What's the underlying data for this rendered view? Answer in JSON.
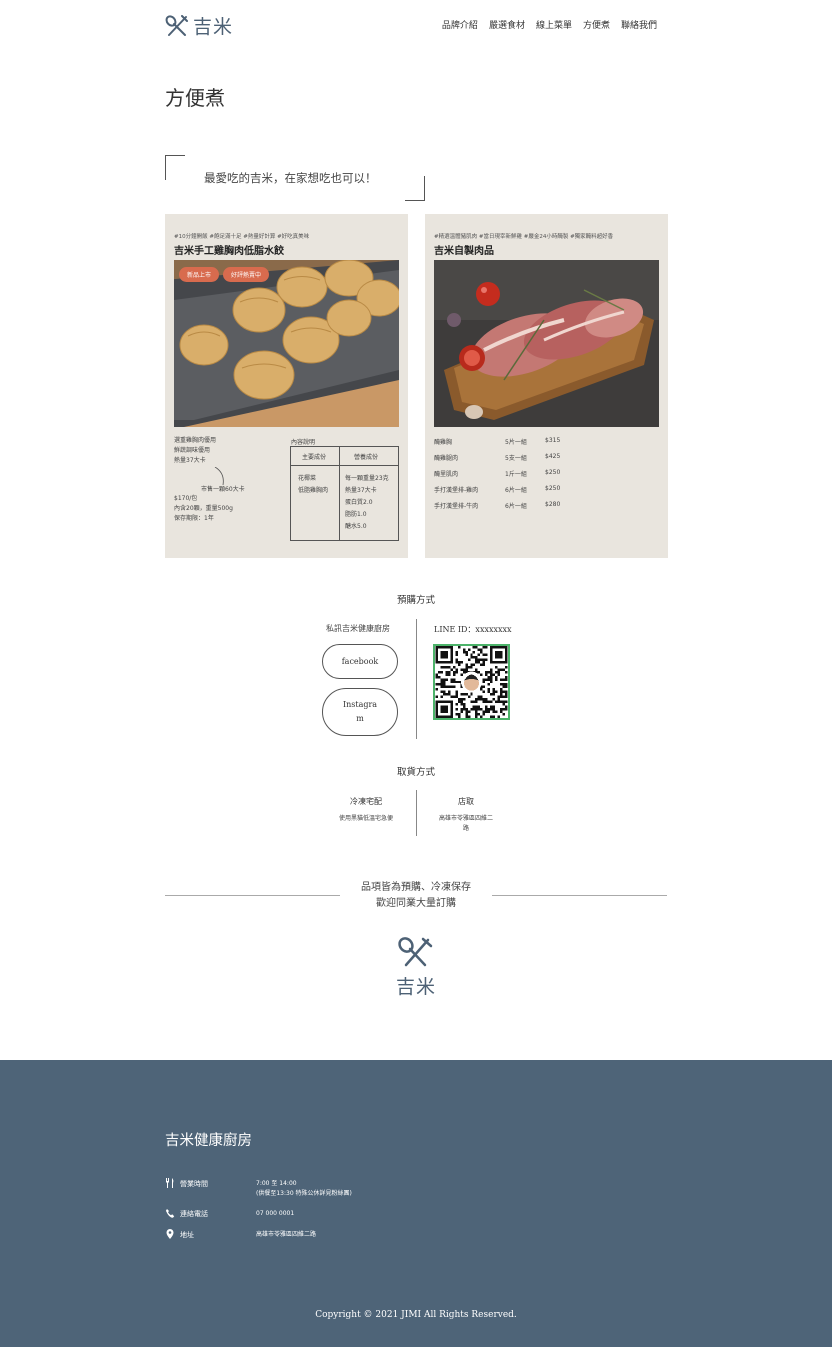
{
  "header": {
    "logo_text": "吉米",
    "nav": [
      "品牌介紹",
      "嚴選食材",
      "線上菜單",
      "方便煮",
      "聯絡我們"
    ]
  },
  "page_title": "方便煮",
  "quote": "最愛吃的吉米，在家想吃也可以！",
  "products": {
    "dumpling": {
      "tags": "#10分鐘開飯 #飽足滿十足 #熱量好計算 #好吃真美味",
      "title": "吉米手工雞胸肉低脂水餃",
      "badges": [
        "新品上市",
        "好評熱賣中"
      ],
      "spec_lines": [
        "選重雞胸肉優用",
        "鮮蔬調味優用",
        "熱量37大卡"
      ],
      "spec_note": "市售一顆60大卡",
      "spec_extra": [
        "$170/包",
        "內含20顆，重量500g",
        "保存期限：1年"
      ],
      "nutrition_label": "內容說明",
      "nutrition_headers": [
        "主要成份",
        "營養成份"
      ],
      "nutrition_main": [
        "花椰菜",
        "低脂雞胸肉"
      ],
      "nutrition_values": [
        "每一顆重量23克",
        "熱量37大卡",
        "蛋白質2.0",
        "脂肪1.0",
        "醣水5.0"
      ]
    },
    "meat": {
      "tags": "#精選溫體豬肌肉 #當日現宰新鮮雞 #嚴金24小時醃製 #獨家醃料超好香",
      "title": "吉米自製肉品",
      "prices": [
        {
          "name": "醃雞胸",
          "qty": "5片一組",
          "price": "$315"
        },
        {
          "name": "醃雞腿肉",
          "qty": "5支一組",
          "price": "$425"
        },
        {
          "name": "醃里肌肉",
          "qty": "1斤一組",
          "price": "$250"
        },
        {
          "name": "手打漢堡排-雞肉",
          "qty": "6片一組",
          "price": "$250"
        },
        {
          "name": "手打漢堡排-牛肉",
          "qty": "6片一組",
          "price": "$280"
        }
      ]
    }
  },
  "order": {
    "title": "預購方式",
    "left_label": "私訊吉米健康廚房",
    "facebook": "facebook",
    "instagram_1": "Instagra",
    "instagram_2": "m",
    "line_id": "LINE ID：xxxxxxxx"
  },
  "pickup": {
    "title": "取貨方式",
    "delivery_title": "冷凍宅配",
    "delivery_desc": "使用黑貓低溫宅急便",
    "store_title": "店取",
    "store_desc_1": "高雄市苓雅區四維二",
    "store_desc_2": "路"
  },
  "notice": [
    "品項皆為預購、冷凍保存",
    "歡迎同業大量訂購"
  ],
  "big_logo_text": "吉米",
  "footer": {
    "title": "吉米健康廚房",
    "hours_label": "營業時間",
    "hours_value_1": "7:00 至 14:00",
    "hours_value_2": "(供餐至13:30 特殊公休詳見粉絲團)",
    "phone_label": "連絡電話",
    "phone_value": "07 000 0001",
    "address_label": "地址",
    "address_value": "高雄市苓雅區四維二路",
    "copyright": "Copyright © 2021 JIMI All Rights Reserved."
  },
  "colors": {
    "brand": "#4e6478",
    "card_bg": "#e9e5de",
    "badge": "#d86b4e",
    "qr_border": "#4cb36a"
  }
}
